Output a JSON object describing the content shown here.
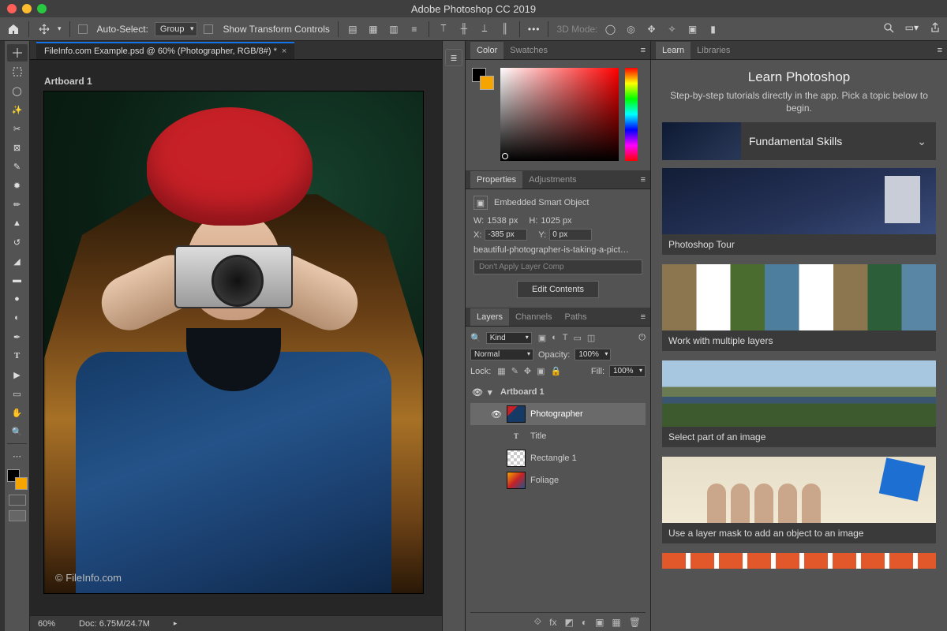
{
  "titlebar": {
    "title": "Adobe Photoshop CC 2019"
  },
  "optbar": {
    "auto_select": "Auto-Select:",
    "group": "Group",
    "show_transform": "Show Transform Controls",
    "mode3d": "3D Mode:"
  },
  "doc": {
    "tab_title": "FileInfo.com Example.psd @ 60% (Photographer, RGB/8#) *",
    "artboard_label": "Artboard 1",
    "watermark": "© FileInfo.com",
    "zoom": "60%",
    "docsize": "Doc: 6.75M/24.7M"
  },
  "panels": {
    "color": {
      "tab_color": "Color",
      "tab_swatches": "Swatches"
    },
    "props": {
      "tab_props": "Properties",
      "tab_adj": "Adjustments",
      "kind": "Embedded Smart Object",
      "w_label": "W:",
      "w_val": "1538 px",
      "h_label": "H:",
      "h_val": "1025 px",
      "x_label": "X:",
      "x_val": "-385 px",
      "y_label": "Y:",
      "y_val": "0 px",
      "filename": "beautiful-photographer-is-taking-a-pict…",
      "layercomp": "Don't Apply Layer Comp",
      "edit_btn": "Edit Contents"
    },
    "layers": {
      "tab_layers": "Layers",
      "tab_channels": "Channels",
      "tab_paths": "Paths",
      "kind": "Kind",
      "blend": "Normal",
      "opacity_label": "Opacity:",
      "opacity": "100%",
      "lock_label": "Lock:",
      "fill_label": "Fill:",
      "fill": "100%",
      "items": [
        {
          "name": "Artboard 1",
          "type": "artboard"
        },
        {
          "name": "Photographer",
          "type": "smart",
          "selected": true
        },
        {
          "name": "Title",
          "type": "text"
        },
        {
          "name": "Rectangle 1",
          "type": "shape"
        },
        {
          "name": "Foliage",
          "type": "smart"
        }
      ]
    }
  },
  "learn": {
    "tab_learn": "Learn",
    "tab_libraries": "Libraries",
    "title": "Learn Photoshop",
    "subtitle": "Step-by-step tutorials directly in the app. Pick a topic below to begin.",
    "section": "Fundamental Skills",
    "cards": [
      "Photoshop Tour",
      "Work with multiple layers",
      "Select part of an image",
      "Use a layer mask to add an object to an image"
    ]
  }
}
